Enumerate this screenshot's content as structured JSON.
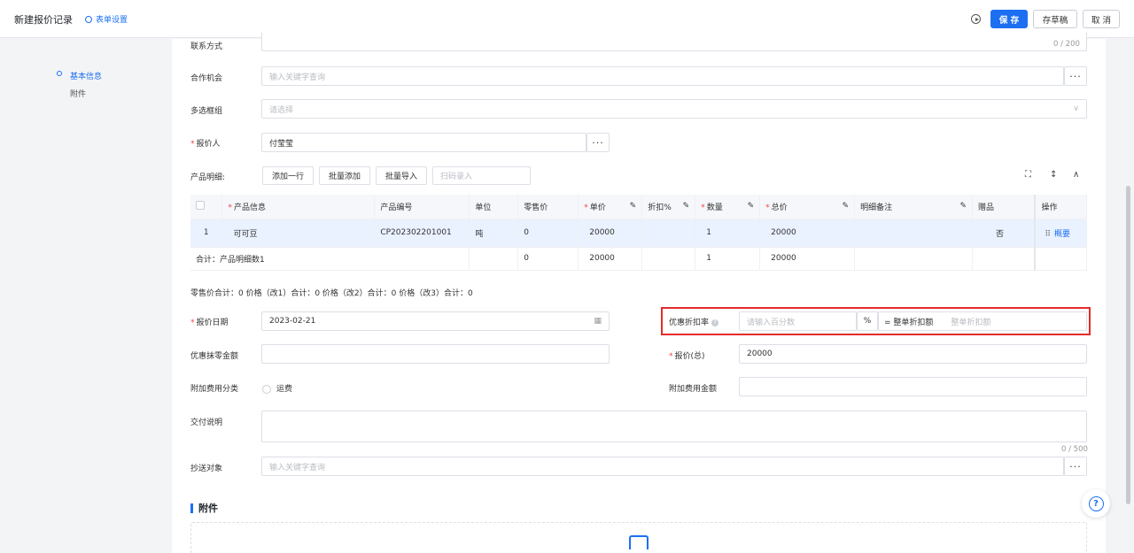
{
  "header": {
    "title": "新建报价记录",
    "form_settings": "表单设置",
    "save": "保 存",
    "draft": "存草稿",
    "cancel": "取 消"
  },
  "nav": {
    "items": [
      {
        "label": "基本信息",
        "active": true
      },
      {
        "label": "附件",
        "active": false
      }
    ]
  },
  "form": {
    "contact": {
      "label": "联系方式",
      "counter": "0 / 200"
    },
    "opportunity": {
      "label": "合作机会",
      "placeholder": "输入关键字查询"
    },
    "multiselect": {
      "label": "多选框组",
      "placeholder": "请选择"
    },
    "quoter": {
      "label": "报价人",
      "value": "付莹莹"
    },
    "product_detail": {
      "label": "产品明细:",
      "buttons": [
        "添加一行",
        "批量添加",
        "批量导入"
      ],
      "scan_placeholder": "扫码录入"
    },
    "table": {
      "columns": [
        "产品信息",
        "产品编号",
        "单位",
        "零售价",
        "单价",
        "折扣%",
        "数量",
        "总价",
        "明细备注",
        "赠品",
        "操作"
      ],
      "rows": [
        {
          "index": "1",
          "product": "可可豆",
          "code": "CP202302201001",
          "unit": "吨",
          "retail": "0",
          "price": "20000",
          "discount": "",
          "qty": "1",
          "total": "20000",
          "remark": "",
          "gift": "否",
          "action": "概要"
        }
      ],
      "summary": {
        "label": "合计：产品明细数1",
        "retail": "0",
        "price": "20000",
        "qty": "1",
        "total": "20000"
      }
    },
    "totals_line": "零售价合计：0 价格（改1）合计：0 价格（改2）合计：0 价格（改3）合计：0",
    "quote_date": {
      "label": "报价日期",
      "value": "2023-02-21"
    },
    "discount_rate": {
      "label": "优惠折扣率",
      "placeholder": "请输入百分数",
      "unit": "%",
      "eq_label": "= 整单折扣额",
      "amount_placeholder": "整单折扣额"
    },
    "rounding": {
      "label": "优惠抹零金额"
    },
    "quote_total": {
      "label": "报价(总)",
      "value": "20000"
    },
    "extra_fee_category": {
      "label": "附加费用分类",
      "option": "运费"
    },
    "extra_fee_amount": {
      "label": "附加费用金额"
    },
    "delivery": {
      "label": "交付说明",
      "counter": "0 / 500"
    },
    "cc": {
      "label": "抄送对象",
      "placeholder": "输入关键字查询"
    }
  },
  "attachments": {
    "title": "附件"
  }
}
